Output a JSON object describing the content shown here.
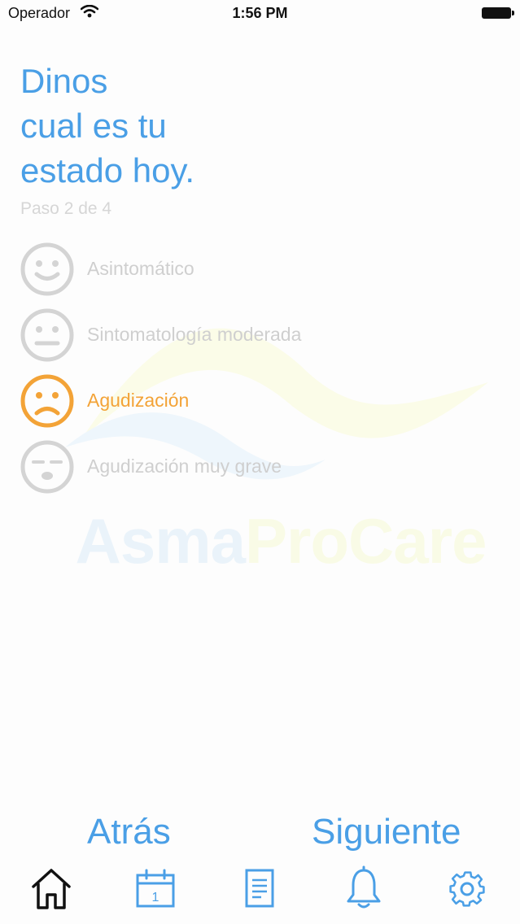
{
  "status_bar": {
    "carrier": "Operador",
    "time": "1:56 PM"
  },
  "watermark": {
    "part1": "Asma",
    "part2": "ProCare"
  },
  "header": {
    "title_lines": [
      "Dinos",
      "cual es tu",
      "estado hoy."
    ],
    "step": "Paso 2 de 4"
  },
  "options": [
    {
      "label": "Asintomático",
      "icon": "happy-face-icon",
      "selected": false
    },
    {
      "label": "Sintomatología moderada",
      "icon": "neutral-face-icon",
      "selected": false
    },
    {
      "label": "Agudización",
      "icon": "sad-face-icon",
      "selected": true
    },
    {
      "label": "Agudización muy grave",
      "icon": "severe-face-icon",
      "selected": false
    }
  ],
  "buttons": {
    "back": "Atrás",
    "next": "Siguiente"
  },
  "tab_bar": {
    "tabs": [
      {
        "icon": "home-icon",
        "active": true
      },
      {
        "icon": "calendar-icon",
        "active": false,
        "day": "1"
      },
      {
        "icon": "document-icon",
        "active": false
      },
      {
        "icon": "bell-icon",
        "active": false
      },
      {
        "icon": "gear-icon",
        "active": false
      }
    ]
  },
  "colors": {
    "accent": "#4a9fe6",
    "selected": "#f3a337",
    "inactive": "#d4d4d4",
    "active_tab": "#111111"
  }
}
